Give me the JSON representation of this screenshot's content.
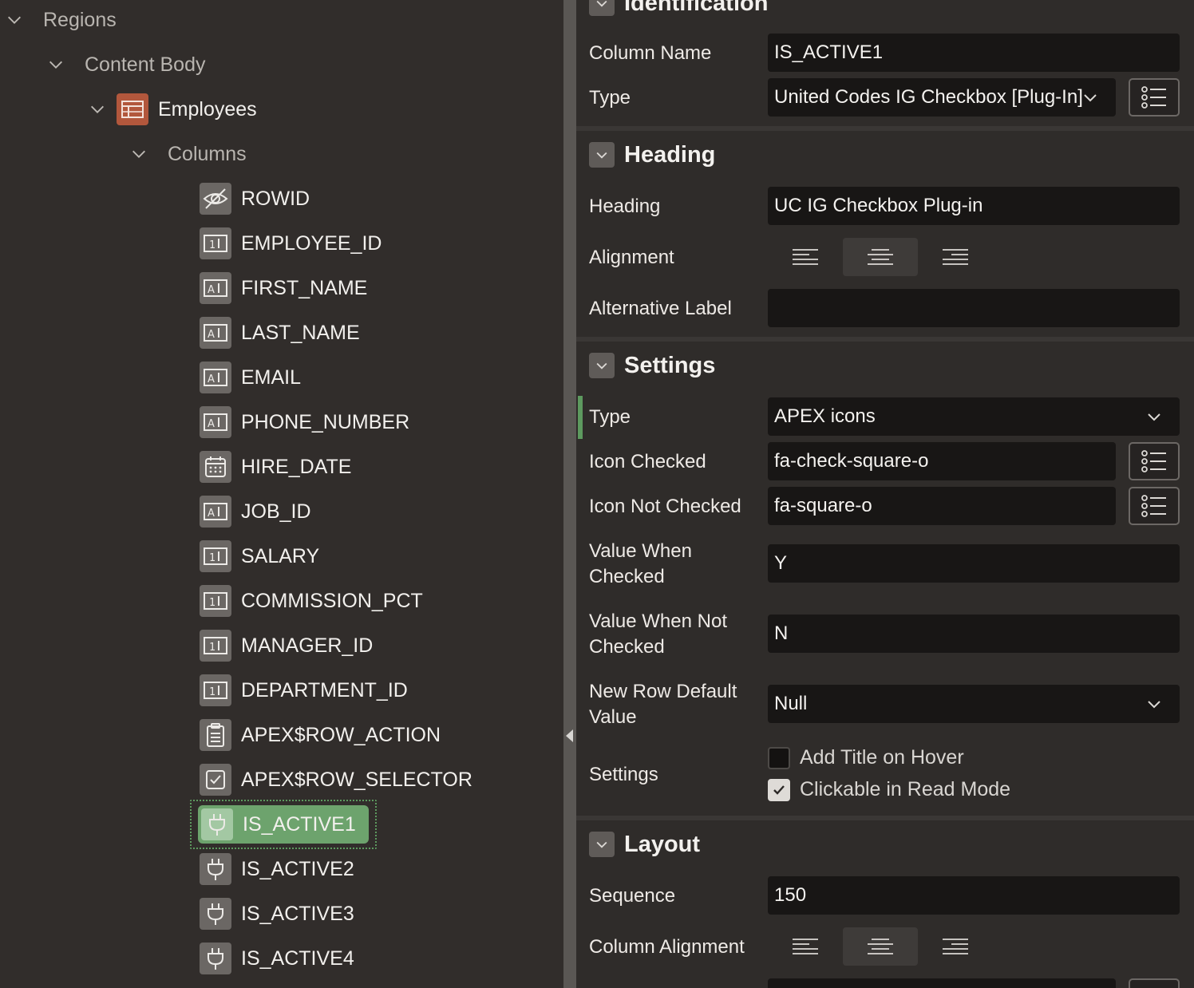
{
  "tree": {
    "regions_label": "Regions",
    "content_body_label": "Content Body",
    "region_name": "Employees",
    "columns_label": "Columns",
    "columns": [
      {
        "name": "ROWID",
        "icon": "hidden-column-icon"
      },
      {
        "name": "EMPLOYEE_ID",
        "icon": "number-field-icon"
      },
      {
        "name": "FIRST_NAME",
        "icon": "text-field-icon"
      },
      {
        "name": "LAST_NAME",
        "icon": "text-field-icon"
      },
      {
        "name": "EMAIL",
        "icon": "text-field-icon"
      },
      {
        "name": "PHONE_NUMBER",
        "icon": "text-field-icon"
      },
      {
        "name": "HIRE_DATE",
        "icon": "date-picker-icon"
      },
      {
        "name": "JOB_ID",
        "icon": "text-field-icon"
      },
      {
        "name": "SALARY",
        "icon": "number-field-icon"
      },
      {
        "name": "COMMISSION_PCT",
        "icon": "number-field-icon"
      },
      {
        "name": "MANAGER_ID",
        "icon": "number-field-icon"
      },
      {
        "name": "DEPARTMENT_ID",
        "icon": "number-field-icon"
      },
      {
        "name": "APEX$ROW_ACTION",
        "icon": "row-action-icon"
      },
      {
        "name": "APEX$ROW_SELECTOR",
        "icon": "row-selector-icon"
      },
      {
        "name": "IS_ACTIVE1",
        "icon": "plugin-icon",
        "selected": true
      },
      {
        "name": "IS_ACTIVE2",
        "icon": "plugin-icon"
      },
      {
        "name": "IS_ACTIVE3",
        "icon": "plugin-icon"
      },
      {
        "name": "IS_ACTIVE4",
        "icon": "plugin-icon"
      }
    ]
  },
  "props": {
    "identification": {
      "title": "Identification",
      "column_name_label": "Column Name",
      "column_name_value": "IS_ACTIVE1",
      "type_label": "Type",
      "type_value": "United Codes IG Checkbox [Plug-In]"
    },
    "heading": {
      "title": "Heading",
      "heading_label": "Heading",
      "heading_value": "UC IG Checkbox Plug-in",
      "alignment_label": "Alignment",
      "alignment_selected": "center",
      "alt_label_label": "Alternative Label",
      "alt_label_value": ""
    },
    "settings": {
      "title": "Settings",
      "type_label": "Type",
      "type_value": "APEX icons",
      "icon_checked_label": "Icon Checked",
      "icon_checked_value": "fa-check-square-o",
      "icon_not_checked_label": "Icon Not Checked",
      "icon_not_checked_value": "fa-square-o",
      "value_checked_label_1": "Value When",
      "value_checked_label_2": "Checked",
      "value_checked_value": "Y",
      "value_not_checked_label_1": "Value When Not",
      "value_not_checked_label_2": "Checked",
      "value_not_checked_value": "N",
      "new_row_label_1": "New Row Default",
      "new_row_label_2": "Value",
      "new_row_value": "Null",
      "settings_label": "Settings",
      "add_title_label": "Add Title on Hover",
      "add_title_checked": false,
      "clickable_label": "Clickable in Read Mode",
      "clickable_checked": true
    },
    "layout": {
      "title": "Layout",
      "sequence_label": "Sequence",
      "sequence_value": "150",
      "column_alignment_label": "Column Alignment",
      "column_alignment_selected": "center"
    }
  },
  "colors": {
    "selected_green": "#6da36d",
    "region_icon": "#b2573c",
    "field_bg": "#181615"
  }
}
